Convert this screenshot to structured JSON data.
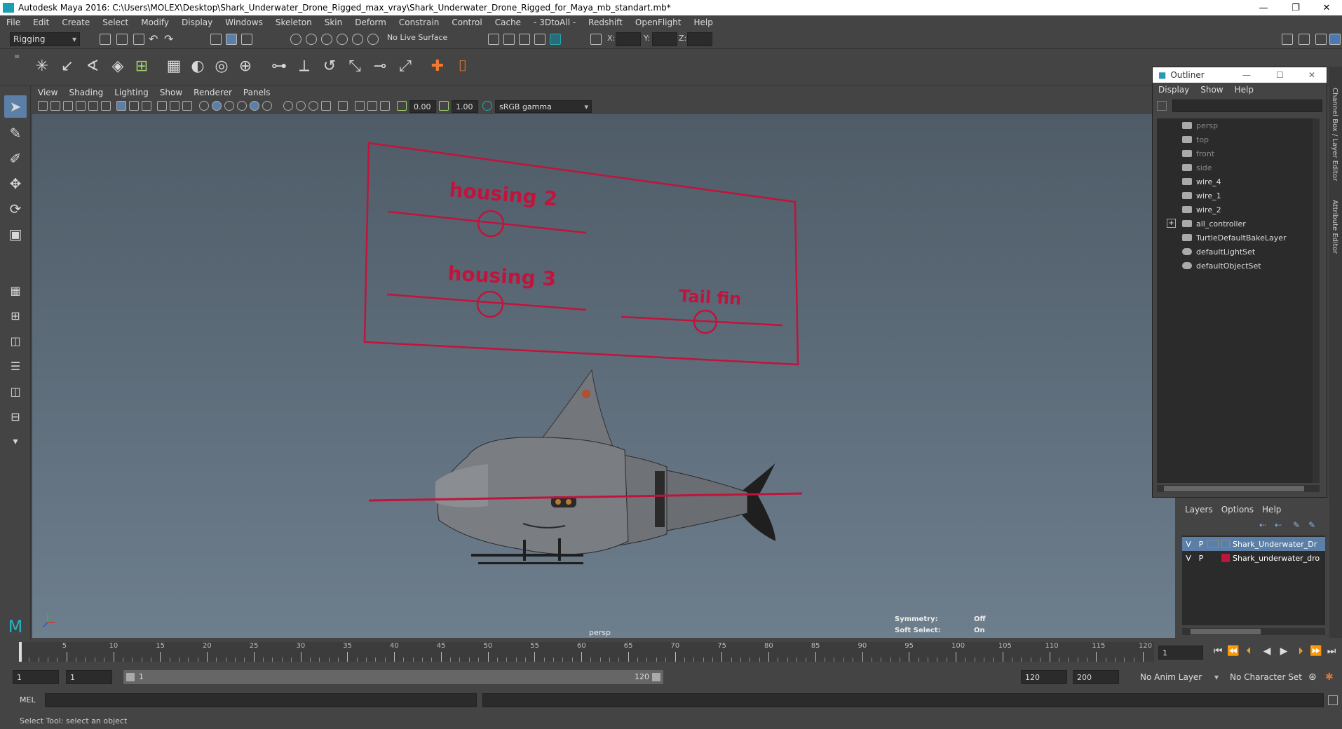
{
  "window": {
    "title": "Autodesk Maya 2016: C:\\Users\\MOLEX\\Desktop\\Shark_Underwater_Drone_Rigged_max_vray\\Shark_Underwater_Drone_Rigged_for_Maya_mb_standart.mb*",
    "controls": [
      "—",
      "❐",
      "✕"
    ]
  },
  "menubar": [
    "File",
    "Edit",
    "Create",
    "Select",
    "Modify",
    "Display",
    "Windows",
    "Skeleton",
    "Skin",
    "Deform",
    "Constrain",
    "Control",
    "Cache",
    "- 3DtoAll -",
    "Redshift",
    "OpenFlight",
    "Help"
  ],
  "statusline": {
    "mode": "Rigging",
    "live_surface": "No Live Surface",
    "x_label": "X:",
    "y_label": "Y:",
    "z_label": "Z:"
  },
  "panel": {
    "menu": [
      "View",
      "Shading",
      "Lighting",
      "Show",
      "Renderer",
      "Panels"
    ],
    "exposure": "0.00",
    "gamma": "1.00",
    "color_space": "sRGB gamma"
  },
  "viewport": {
    "camera_label": "persp",
    "controls": [
      "housing 2",
      "housing 3",
      "Tail fin"
    ],
    "hud": {
      "symmetry_label": "Symmetry:",
      "symmetry_value": "Off",
      "soft_select_label": "Soft Select:",
      "soft_select_value": "On"
    },
    "control_color": "#c0143c"
  },
  "outliner": {
    "title": "Outliner",
    "menu": [
      "Display",
      "Show",
      "Help"
    ],
    "items": [
      {
        "label": "persp",
        "dim": true
      },
      {
        "label": "top",
        "dim": true
      },
      {
        "label": "front",
        "dim": true
      },
      {
        "label": "side",
        "dim": true
      },
      {
        "label": "wire_4",
        "dim": false
      },
      {
        "label": "wire_1",
        "dim": false
      },
      {
        "label": "wire_2",
        "dim": false
      },
      {
        "label": "all_controller",
        "dim": false
      },
      {
        "label": "TurtleDefaultBakeLayer",
        "dim": false
      },
      {
        "label": "defaultLightSet",
        "dim": false
      },
      {
        "label": "defaultObjectSet",
        "dim": false
      }
    ],
    "side_tabs": [
      "Channel Box / Layer Editor",
      "Attribute Editor"
    ]
  },
  "layers": {
    "menu": [
      "Layers",
      "Options",
      "Help"
    ],
    "rows": [
      {
        "v": "V",
        "p": "P",
        "name": "Shark_Underwater_Dr",
        "color": "",
        "selected": true
      },
      {
        "v": "V",
        "p": "P",
        "name": "Shark_underwater_dro",
        "color": "#c0143c",
        "selected": false
      }
    ]
  },
  "timeline": {
    "ticks": [
      "5",
      "10",
      "15",
      "20",
      "25",
      "30",
      "35",
      "40",
      "45",
      "50",
      "55",
      "60",
      "65",
      "70",
      "75",
      "80",
      "85",
      "90",
      "95",
      "100",
      "105",
      "110",
      "115",
      "120"
    ],
    "current_frame": "1",
    "current_frame_field": "1"
  },
  "range": {
    "start": "1",
    "playback_start": "1",
    "slider_start": "1",
    "slider_end": "120",
    "playback_end": "120",
    "end": "200",
    "anim_layer": "No Anim Layer",
    "character_set": "No Character Set"
  },
  "command": {
    "label": "MEL"
  },
  "help_line": "Select Tool: select an object"
}
